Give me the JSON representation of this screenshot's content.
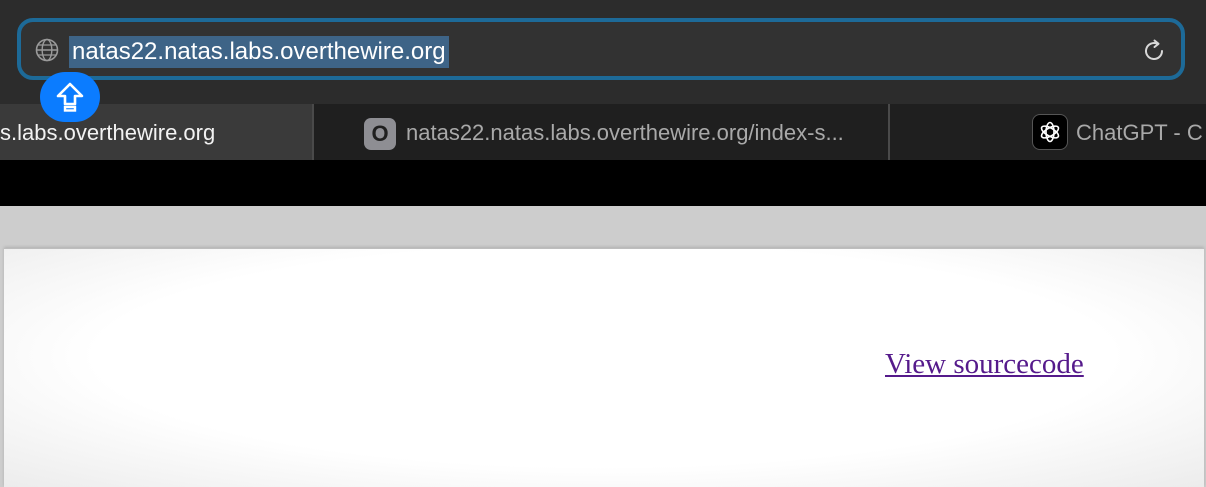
{
  "browser": {
    "address_bar": {
      "url": "natas22.natas.labs.overthewire.org",
      "icon": "globe-icon",
      "reload_icon": "reload-icon"
    },
    "share_badge_icon": "share-upload-icon",
    "tabs": [
      {
        "label": "s.labs.overthewire.org",
        "active": true
      },
      {
        "label": "natas22.natas.labs.overthewire.org/index-s...",
        "favicon": "O",
        "active": false
      },
      {
        "label": "ChatGPT - C",
        "favicon": "chatgpt-icon",
        "active": false
      }
    ]
  },
  "page": {
    "link_text": "View sourcecode",
    "link_color": "#551a8b"
  }
}
